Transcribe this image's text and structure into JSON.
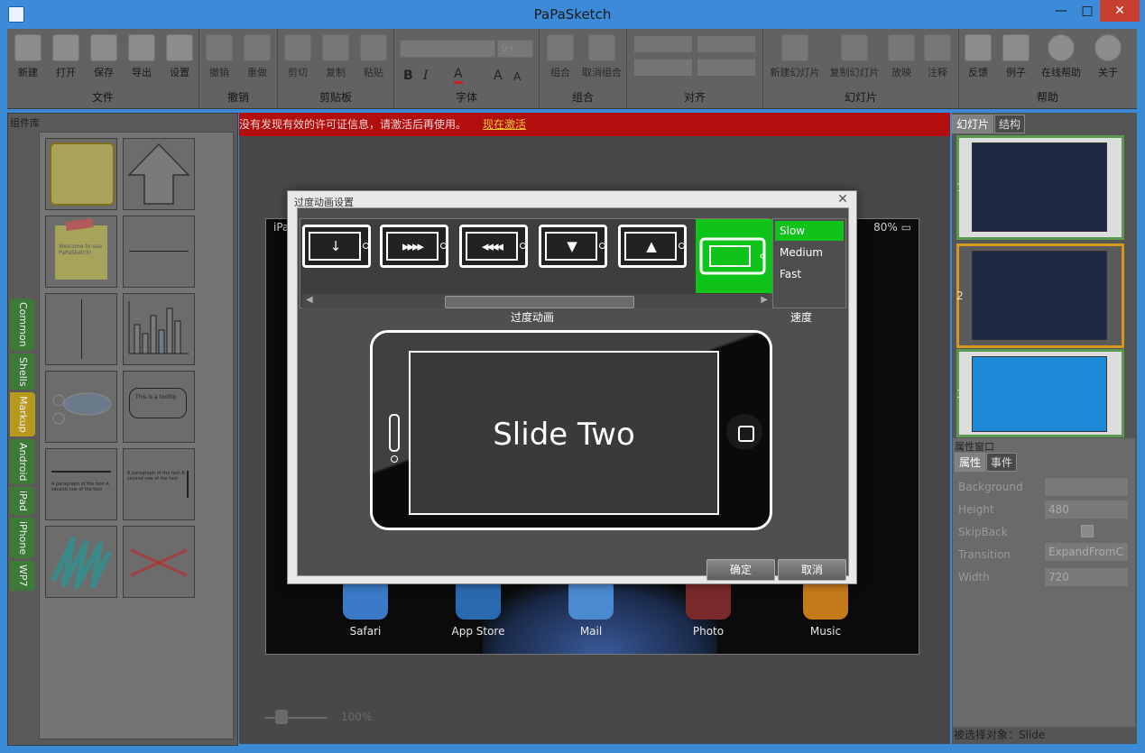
{
  "window": {
    "title": "PaPaSketch"
  },
  "ribbon": {
    "groups": [
      {
        "label": "文件",
        "buttons": [
          "新建",
          "打开",
          "保存",
          "导出",
          "设置"
        ]
      },
      {
        "label": "撤销",
        "buttons": [
          "撤销",
          "重做"
        ]
      },
      {
        "label": "剪贴板",
        "buttons": [
          "剪切",
          "复制",
          "粘贴"
        ]
      },
      {
        "label": "字体",
        "buttons": []
      },
      {
        "label": "组合",
        "buttons": [
          "组合",
          "取消组合"
        ]
      },
      {
        "label": "对齐",
        "buttons": []
      },
      {
        "label": "幻灯片",
        "buttons": [
          "新建幻灯片",
          "复制幻灯片",
          "放映",
          "注释"
        ]
      },
      {
        "label": "帮助",
        "buttons": [
          "反馈",
          "例子",
          "在线帮助",
          "关于"
        ]
      }
    ]
  },
  "left_panel": {
    "title": "组件库",
    "vertical_tabs": [
      "Common",
      "Shells",
      "Markup",
      "Android",
      "iPad",
      "iPhone",
      "WP7"
    ],
    "active_tab": "Markup",
    "stencils": {
      "sticky_note": "Welcome to use PaPaSketch!",
      "tooltip": "This is a tooltip",
      "paragraph": "A paragraph of the text A second row of the text"
    }
  },
  "license_bar": {
    "message": "没有发现有效的许可证信息，请激活后再使用。",
    "activate_link": "现在激活"
  },
  "canvas": {
    "device_label": "iPa",
    "battery": "80%",
    "dock_apps": [
      "Safari",
      "App Store",
      "Mail",
      "Photo",
      "Music"
    ],
    "zoom": "100%"
  },
  "right_panel": {
    "tabs": [
      "幻灯片",
      "结构"
    ],
    "slides": [
      "1",
      "2",
      "3"
    ],
    "props_title": "属性窗口",
    "props_tabs": [
      "属性",
      "事件"
    ],
    "props": [
      {
        "name": "Background",
        "value": ""
      },
      {
        "name": "Height",
        "value": "480"
      },
      {
        "name": "SkipBack",
        "value": ""
      },
      {
        "name": "Transition",
        "value": "ExpandFromC"
      },
      {
        "name": "Width",
        "value": "720"
      }
    ],
    "selected_object": "被选择对象：Slide"
  },
  "dialog": {
    "title": "过度动画设置",
    "transitions": [
      "↓",
      "▸▸▸▸",
      "◂◂◂◂",
      "▼",
      "▲",
      "expand"
    ],
    "strip_label": "过度动画",
    "speeds": [
      "Slow",
      "Medium",
      "Fast"
    ],
    "selected_speed": "Slow",
    "speed_label": "速度",
    "preview_text": "Slide Two",
    "ok_button": "确定",
    "cancel_button": "取消"
  }
}
